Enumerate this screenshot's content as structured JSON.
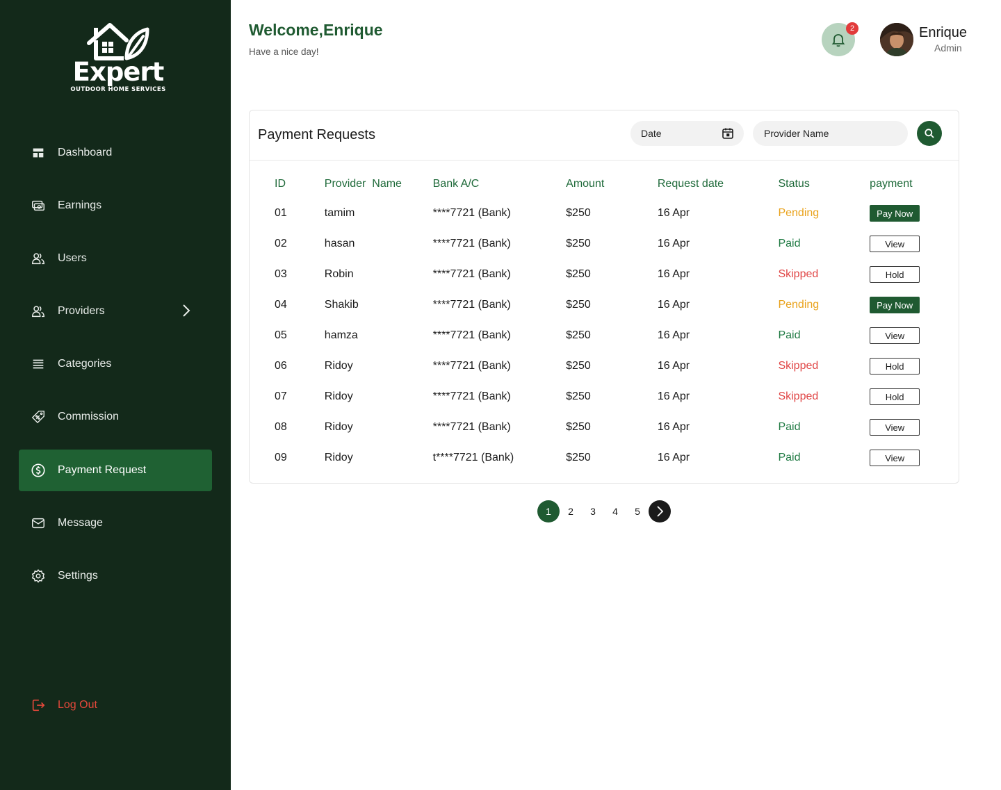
{
  "brand": {
    "name": "Expert",
    "tagline": "OUTDOOR HOME SERVICES"
  },
  "sidebar": {
    "items": [
      {
        "label": "Dashboard",
        "icon": "dashboard-icon"
      },
      {
        "label": "Earnings",
        "icon": "cash-icon"
      },
      {
        "label": "Users",
        "icon": "users-icon"
      },
      {
        "label": "Providers",
        "icon": "users-icon"
      },
      {
        "label": "Categories",
        "icon": "list-icon"
      },
      {
        "label": "Commission",
        "icon": "tag-percent-icon"
      },
      {
        "label": "Payment Request",
        "icon": "dollar-circle-icon",
        "active": true
      },
      {
        "label": "Message",
        "icon": "mail-icon"
      },
      {
        "label": "Settings",
        "icon": "gear-icon"
      }
    ],
    "logout": "Log Out"
  },
  "header": {
    "welcome": "Welcome,Enrique",
    "subtitle": "Have a nice day!",
    "notification_count": "2",
    "user_name": "Enrique",
    "user_role": "Admin"
  },
  "payments": {
    "title": "Payment Requests",
    "date_filter": "Date",
    "provider_placeholder": "Provider Name",
    "columns": [
      "ID",
      "Provider  Name",
      "Bank A/C",
      "Amount",
      "Request date",
      "Status",
      "payment"
    ],
    "rows": [
      {
        "id": "01",
        "name": "tamim",
        "bank": "****7721 (Bank)",
        "amount": "$250",
        "date": "16 Apr",
        "status": "Pending",
        "action": "Pay Now"
      },
      {
        "id": "02",
        "name": "hasan",
        "bank": "****7721 (Bank)",
        "amount": "$250",
        "date": "16 Apr",
        "status": "Paid",
        "action": "View"
      },
      {
        "id": "03",
        "name": "Robin",
        "bank": "****7721 (Bank)",
        "amount": "$250",
        "date": "16 Apr",
        "status": "Skipped",
        "action": "Hold"
      },
      {
        "id": "04",
        "name": "Shakib",
        "bank": "****7721 (Bank)",
        "amount": "$250",
        "date": "16 Apr",
        "status": "Pending",
        "action": "Pay Now"
      },
      {
        "id": "05",
        "name": "hamza",
        "bank": "****7721 (Bank)",
        "amount": "$250",
        "date": "16 Apr",
        "status": "Paid",
        "action": "View"
      },
      {
        "id": "06",
        "name": "Ridoy",
        "bank": "****7721 (Bank)",
        "amount": "$250",
        "date": "16 Apr",
        "status": "Skipped",
        "action": "Hold"
      },
      {
        "id": "07",
        "name": "Ridoy",
        "bank": "****7721 (Bank)",
        "amount": "$250",
        "date": "16 Apr",
        "status": "Skipped",
        "action": "Hold"
      },
      {
        "id": "08",
        "name": "Ridoy",
        "bank": "****7721 (Bank)",
        "amount": "$250",
        "date": "16 Apr",
        "status": "Paid",
        "action": "View"
      },
      {
        "id": "09",
        "name": "Ridoy",
        "bank": "t****7721 (Bank)",
        "amount": "$250",
        "date": "16 Apr",
        "status": "Paid",
        "action": "View"
      }
    ]
  },
  "pagination": {
    "pages": [
      "1",
      "2",
      "3",
      "4",
      "5"
    ],
    "current": "1"
  },
  "colors": {
    "sidebar_bg": "#13291a",
    "accent": "#1f5a31",
    "pending": "#e9a21b",
    "paid": "#1f7a43",
    "skipped": "#e04646"
  }
}
